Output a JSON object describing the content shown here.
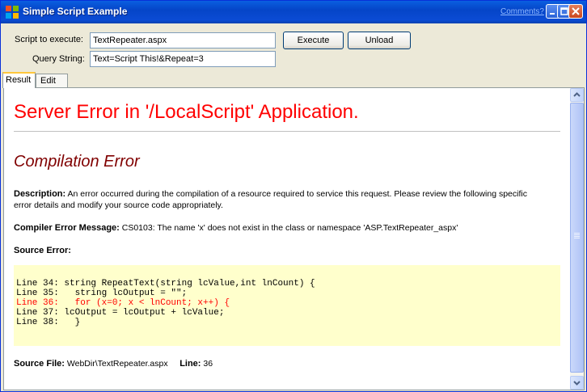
{
  "window": {
    "title": "Simple Script Example",
    "comments_link": "Comments?",
    "colors": {
      "titlebar": "#0A5FE0",
      "face": "#ECE9D8"
    }
  },
  "form": {
    "script_label": "Script to execute:",
    "script_value": "TextRepeater.aspx",
    "query_label": "Query String:",
    "query_value": "Text=Script This!&Repeat=3",
    "execute_label": "Execute",
    "unload_label": "Unload"
  },
  "tabs": [
    {
      "label": "Result",
      "selected": true
    },
    {
      "label": "Edit",
      "selected": false
    }
  ],
  "result": {
    "error_title": "Server Error in '/LocalScript' Application.",
    "error_subtitle": "Compilation Error",
    "description_label": "Description:",
    "description_text": "An error occurred during the compilation of a resource required to service this request. Please review the following specific error details and modify your source code appropriately.",
    "compiler_label": "Compiler Error Message:",
    "compiler_text": "CS0103: The name 'x' does not exist in the class or namespace 'ASP.TextRepeater_aspx'",
    "source_error_label": "Source Error:",
    "code_lines": [
      "Line 34: string RepeatText(string lcValue,int lnCount) {",
      "Line 35:   string lcOutput = \"\";",
      "Line 36:   for (x=0; x < lnCount; x++) {",
      "Line 37: lcOutput = lcOutput + lcValue;",
      "Line 38:   }"
    ],
    "source_file_label": "Source File:",
    "source_file_value": "WebDir\\TextRepeater.aspx",
    "line_label": "Line:",
    "line_value": "36",
    "colors": {
      "error_title": "#FF0000",
      "subtitle": "#800000",
      "code_bg": "#FFFFCC",
      "highlight": "#FF0000"
    }
  }
}
